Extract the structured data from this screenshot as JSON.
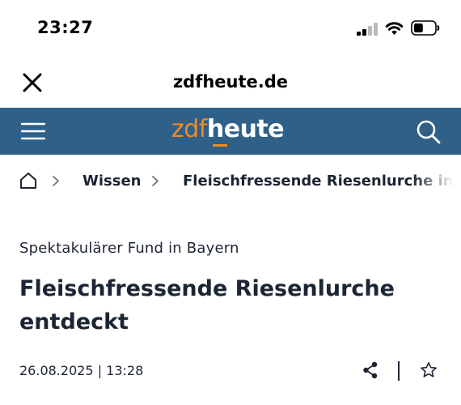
{
  "status_bar": {
    "time": "23:27",
    "signal_bars_filled": 2,
    "signal_bars_total": 4,
    "battery_level": 0.45
  },
  "browser": {
    "domain": "zdfheute.de",
    "close_icon": "close-icon"
  },
  "header": {
    "logo_zdf": "zdf",
    "logo_heute": "heute",
    "menu_icon": "hamburger-menu-icon",
    "search_icon": "search-icon",
    "colors": {
      "background": "#2f6088",
      "accent": "#f08a24"
    }
  },
  "breadcrumb": {
    "home_icon": "home-icon",
    "items": [
      {
        "label": "Wissen"
      },
      {
        "label": "Fleischfressende Riesenlurche in Bayern"
      }
    ]
  },
  "article": {
    "kicker": "Spektakulärer Fund in Bayern",
    "headline": "Fleischfressende Riesenlurche entdeckt",
    "date": "26.08.2025 | 13:28",
    "share_icon": "share-icon",
    "bookmark_icon": "star-icon"
  }
}
